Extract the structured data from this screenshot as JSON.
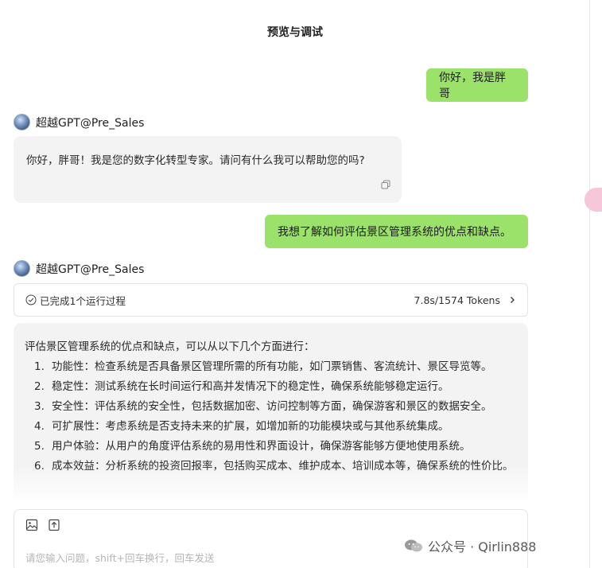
{
  "header": {
    "title": "预览与调试"
  },
  "messages": {
    "user1": "你好，我是胖哥",
    "bot_name": "超越GPT@Pre_Sales",
    "bot1": "你好，胖哥！我是您的数字化转型专家。请问有什么我可以帮助您的吗?",
    "user2": "我想了解如何评估景区管理系统的优点和缺点。"
  },
  "run": {
    "label": "已完成1个运行过程",
    "tokens": "7.8s/1574 Tokens"
  },
  "answer": {
    "intro": "评估景区管理系统的优点和缺点，可以从以下几个方面进行：",
    "items": [
      {
        "num": "1.",
        "text": "功能性：检查系统是否具备景区管理所需的所有功能，如门票销售、客流统计、景区导览等。"
      },
      {
        "num": "2.",
        "text": "稳定性：测试系统在长时间运行和高并发情况下的稳定性，确保系统能够稳定运行。"
      },
      {
        "num": "3.",
        "text": "安全性：评估系统的安全性，包括数据加密、访问控制等方面，确保游客和景区的数据安全。"
      },
      {
        "num": "4.",
        "text": "可扩展性：考虑系统是否支持未来的扩展，如增加新的功能模块或与其他系统集成。"
      },
      {
        "num": "5.",
        "text": "用户体验：从用户的角度评估系统的易用性和界面设计，确保游客能够方便地使用系统。"
      },
      {
        "num": "6.",
        "text": "成本效益：分析系统的投资回报率，包括购买成本、维护成本、培训成本等，确保系统的性价比。"
      }
    ]
  },
  "input": {
    "placeholder": "请您输入问题，shift+回车换行，回车发送"
  },
  "watermark": {
    "text": "公众号 · Qirlin888"
  },
  "icons": {
    "avatar": "avatar",
    "copy": "copy-icon",
    "check": "check-circle-icon",
    "chevron": "chevron-right-icon",
    "image": "image-icon",
    "upload": "upload-icon",
    "wechat": "wechat-icon"
  },
  "colors": {
    "user_bubble": "#9be26a",
    "bot_bubble": "#f3f3f3",
    "accent_pink": "#f6c6d9"
  }
}
